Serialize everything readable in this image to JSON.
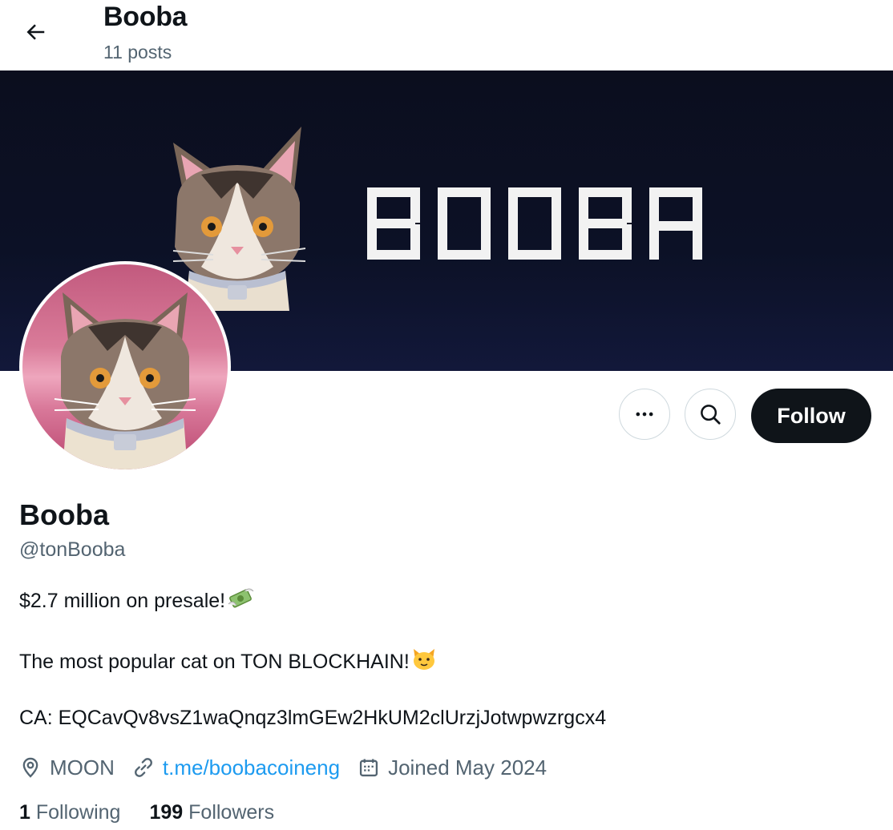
{
  "header": {
    "title": "Booba",
    "posts_count": "11 posts"
  },
  "banner": {
    "word": "BOOBA"
  },
  "actions": {
    "follow_label": "Follow"
  },
  "profile": {
    "name": "Booba",
    "handle": "@tonBooba",
    "bio": {
      "line1": "$2.7 million on presale!",
      "line2": "The most popular cat on TON BLOCKHAIN!",
      "line3": "CA: EQCavQv8vsZ1waQnqz3lmGEw2HkUM2clUrzjJotwpwzrgcx4"
    },
    "location": "MOON",
    "website": "t.me/boobacoineng",
    "joined": "Joined May 2024"
  },
  "stats": {
    "following_count": "1",
    "following_label": "Following",
    "followers_count": "199",
    "followers_label": "Followers"
  },
  "icons": {
    "back": "arrow-left-icon",
    "more": "more-horizontal-icon",
    "search": "search-icon",
    "location": "location-pin-icon",
    "link": "link-icon",
    "calendar": "calendar-icon",
    "money": "money-with-wings-emoji",
    "cat": "cat-face-emoji"
  },
  "colors": {
    "accent": "#1d9bf0",
    "text": "#0f1419",
    "secondary": "#536471",
    "follow_bg": "#0f1419"
  }
}
